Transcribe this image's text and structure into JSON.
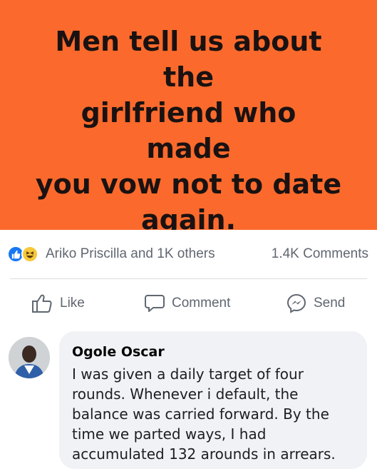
{
  "banner": {
    "headline": "Men tell us about the\ngirlfriend who made\nyou vow not to date\nagain.",
    "background_color": "#fb6a2c"
  },
  "reactions": {
    "icons": [
      "like-icon",
      "haha-icon"
    ],
    "reactors_text": "Ariko Priscilla and 1K others",
    "comments_count": "1.4K Comments"
  },
  "actions": {
    "like_label": "Like",
    "comment_label": "Comment",
    "send_label": "Send"
  },
  "comment": {
    "author": "Ogole Oscar",
    "text": "I was given a daily target of four\nrounds. Whenever i default, the\nbalance was carried forward. By the\ntime we parted ways, I had\naccumulated 132 arounds in arrears."
  }
}
